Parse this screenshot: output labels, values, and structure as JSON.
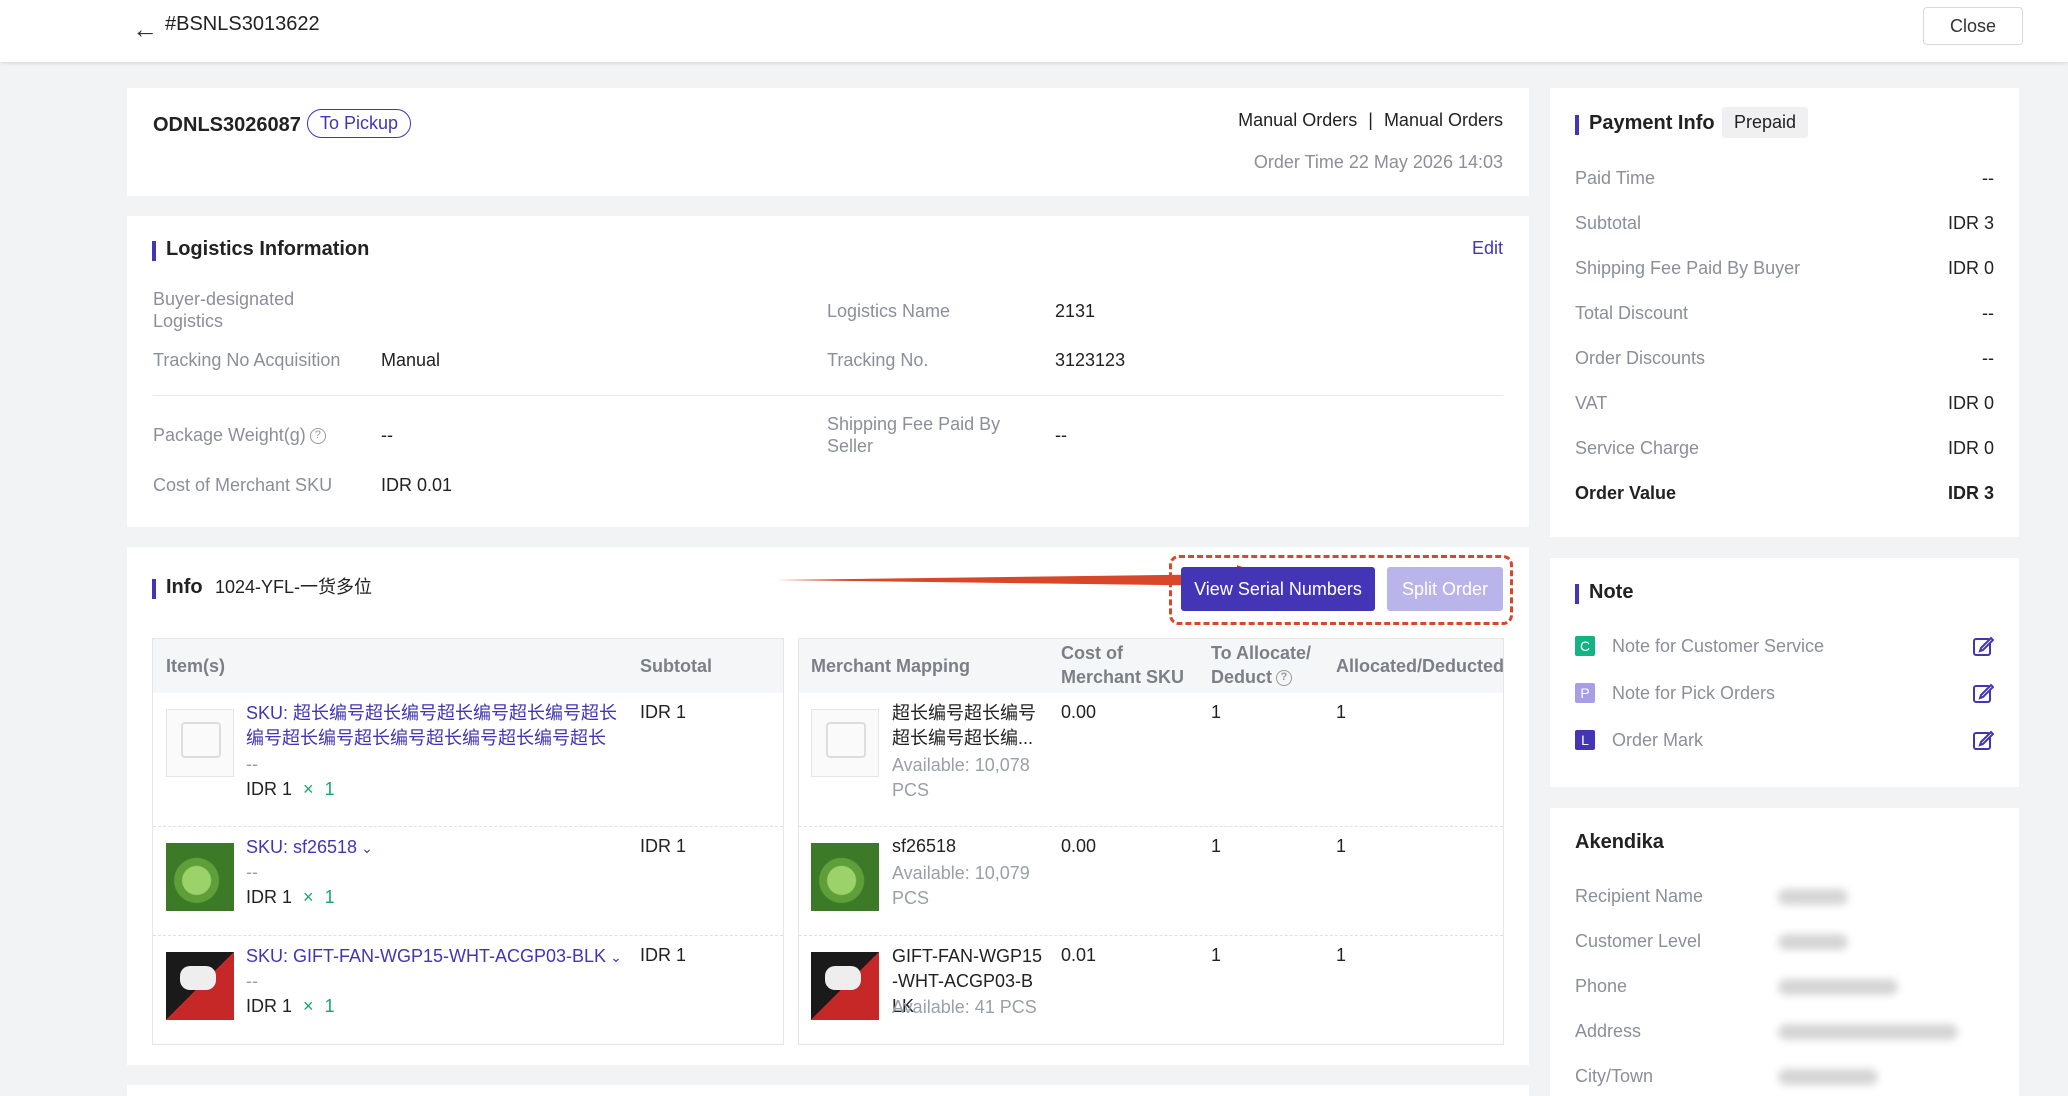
{
  "header": {
    "order_no": "#BSNLS3013622",
    "close_label": "Close"
  },
  "order": {
    "id": "ODNLS3026087",
    "status": "To Pickup",
    "source_a": "Manual Orders",
    "source_sep": "|",
    "source_b": "Manual Orders",
    "order_time": "Order Time 22 May 2026 14:03"
  },
  "logistics": {
    "title": "Logistics Information",
    "edit_label": "Edit",
    "buyer_designated_label": "Buyer-designated Logistics",
    "logistics_name_label": "Logistics Name",
    "logistics_name": "2131",
    "tracking_acq_label": "Tracking No Acquisition",
    "tracking_acq": "Manual",
    "tracking_no_label": "Tracking No.",
    "tracking_no": "3123123",
    "package_weight_label": "Package Weight(g)",
    "package_weight": "--",
    "shipping_seller_label": "Shipping Fee Paid By Seller",
    "shipping_seller": "--",
    "cost_sku_label": "Cost of Merchant SKU",
    "cost_sku": "IDR 0.01"
  },
  "info": {
    "title": "Info",
    "warehouse": "1024-YFL-一货多位",
    "view_serial_label": "View Serial Numbers",
    "split_order_label": "Split Order",
    "headers": {
      "items": "Item(s)",
      "subtotal": "Subtotal",
      "merchant_mapping": "Merchant Mapping",
      "cost": "Cost of Merchant SKU",
      "allocate": "To Allocate/ Deduct",
      "allocated": "Allocated/Deducted"
    },
    "rows": [
      {
        "sku": "SKU: 超长编号超长编号超长编号超长编号超长编号超长编号超长编号超长编号超长编号超长编...",
        "dash": "--",
        "price": "IDR 1",
        "x": "×",
        "qty": "1",
        "subtotal": "IDR 1",
        "mapping_name": "超长编号超长编号超长编号超长编...",
        "available": "Available: 10,078 PCS",
        "cost": "0.00",
        "allocate": "1",
        "allocated": "1"
      },
      {
        "sku": "SKU: sf26518",
        "dash": "--",
        "price": "IDR 1",
        "x": "×",
        "qty": "1",
        "subtotal": "IDR 1",
        "mapping_name": "sf26518",
        "available": "Available: 10,079 PCS",
        "cost": "0.00",
        "allocate": "1",
        "allocated": "1"
      },
      {
        "sku": "SKU: GIFT-FAN-WGP15-WHT-ACGP03-BLK",
        "dash": "--",
        "price": "IDR 1",
        "x": "×",
        "qty": "1",
        "subtotal": "IDR 1",
        "mapping_name": "GIFT-FAN-WGP15-WHT-ACGP03-BLK",
        "available": "Available: 41 PCS",
        "cost": "0.01",
        "allocate": "1",
        "allocated": "1"
      }
    ]
  },
  "payment": {
    "title": "Payment Info",
    "badge": "Prepaid",
    "rows": [
      {
        "label": "Paid Time",
        "value": "--"
      },
      {
        "label": "Subtotal",
        "value": "IDR 3"
      },
      {
        "label": "Shipping Fee Paid By Buyer",
        "value": "IDR 0"
      },
      {
        "label": "Total Discount",
        "value": "--"
      },
      {
        "label": "Order Discounts",
        "value": "--"
      },
      {
        "label": "VAT",
        "value": "IDR 0"
      },
      {
        "label": "Service Charge",
        "value": "IDR 0"
      },
      {
        "label": "Order Value",
        "value": "IDR 3"
      }
    ]
  },
  "note": {
    "title": "Note",
    "items": [
      {
        "badge": "C",
        "label": "Note for Customer Service",
        "color": "#14b383"
      },
      {
        "badge": "P",
        "label": "Note for Pick Orders",
        "color": "#a89ee8"
      },
      {
        "badge": "L",
        "label": "Order Mark",
        "color": "#4335b5"
      }
    ]
  },
  "customer": {
    "title": "Akendika",
    "labels": [
      "Recipient Name",
      "Customer Level",
      "Phone",
      "Address",
      "City/Town"
    ]
  },
  "colors": {
    "accent": "#4335b5",
    "annotation": "#d9472b"
  }
}
